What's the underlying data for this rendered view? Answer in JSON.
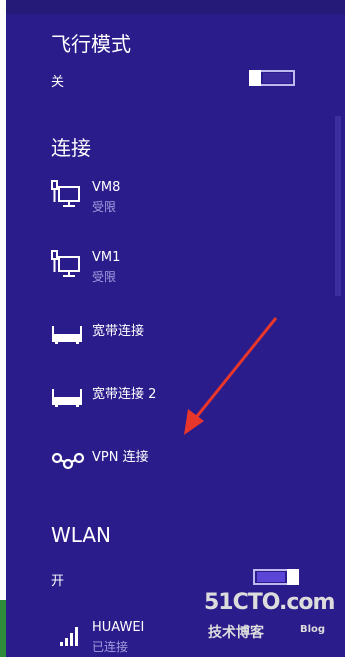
{
  "airplane": {
    "title": "飞行模式",
    "state_label": "关",
    "on": false
  },
  "connections": {
    "title": "连接",
    "items": [
      {
        "name": "VM8",
        "status": "受限",
        "icon": "ethernet-icon"
      },
      {
        "name": "VM1",
        "status": "受限",
        "icon": "ethernet-icon"
      },
      {
        "name": "宽带连接",
        "status": "",
        "icon": "broadband-icon"
      },
      {
        "name": "宽带连接 2",
        "status": "",
        "icon": "broadband-icon"
      },
      {
        "name": "VPN 连接",
        "status": "",
        "icon": "vpn-icon"
      }
    ]
  },
  "wlan": {
    "title": "WLAN",
    "state_label": "开",
    "on": true,
    "networks": [
      {
        "name": "HUAWEI",
        "status": "已连接",
        "icon": "wifi-signal-icon"
      }
    ]
  },
  "watermark": {
    "main": "51CTO.com",
    "sub": "技术博客",
    "blog": "Blog"
  },
  "colors": {
    "panel_bg": "#2b1c8c",
    "accent": "#5a45d6",
    "status_text": "#a59ee0",
    "arrow": "#e8362a"
  }
}
